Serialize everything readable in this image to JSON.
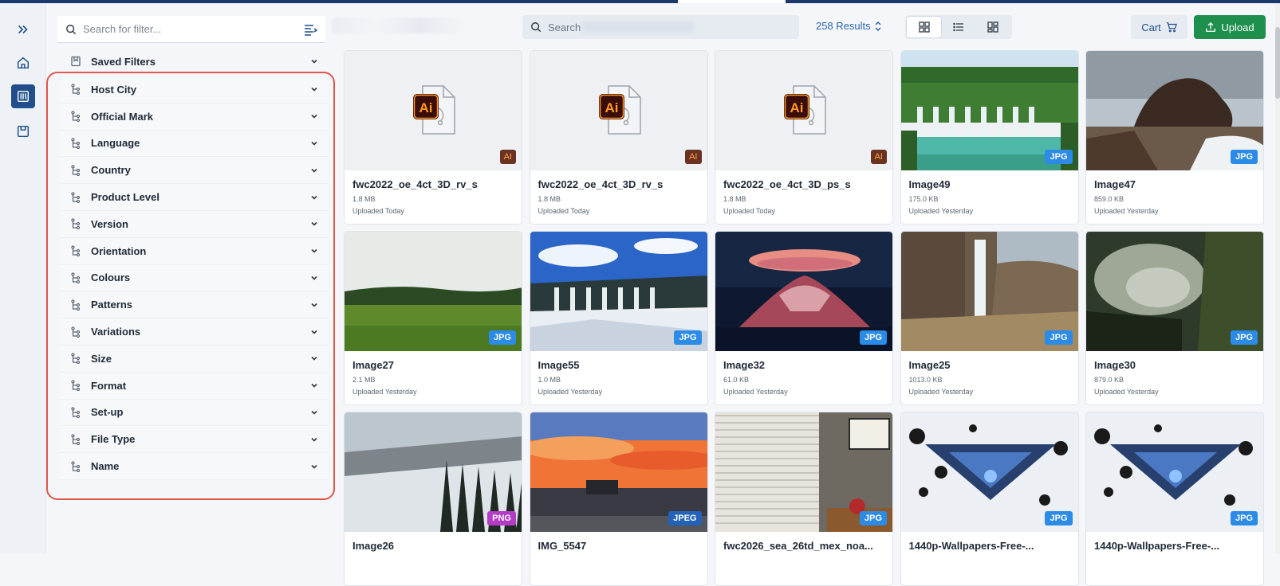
{
  "filter_panel": {
    "search_placeholder": "Search for filter...",
    "saved_filters_label": "Saved Filters",
    "facets": [
      "Host City",
      "Official Mark",
      "Language",
      "Country",
      "Product Level",
      "Version",
      "Orientation",
      "Colours",
      "Patterns",
      "Variations",
      "Size",
      "Format",
      "Set-up",
      "File Type",
      "Name"
    ]
  },
  "toolbar": {
    "search_placeholder": "Search",
    "results_label": "258 Results",
    "cart_label": "Cart",
    "upload_label": "Upload"
  },
  "colors": {
    "brand_navy": "#1f4e8a",
    "upload_green": "#1f8f4e",
    "highlight_red": "#e0584a",
    "jpg_badge": "#2b8be6",
    "png_badge": "#b43bc6"
  },
  "assets": [
    {
      "title": "fwc2022_oe_4ct_3D_rv_s",
      "size": "1.8 MB",
      "uploaded": "Uploaded Today",
      "badge": "AI",
      "kind": "ai"
    },
    {
      "title": "fwc2022_oe_4ct_3D_rv_s",
      "size": "1.8 MB",
      "uploaded": "Uploaded Today",
      "badge": "AI",
      "kind": "ai"
    },
    {
      "title": "fwc2022_oe_4ct_3D_ps_s",
      "size": "1.8 MB",
      "uploaded": "Uploaded Today",
      "badge": "AI",
      "kind": "ai"
    },
    {
      "title": "Image49",
      "size": "175.0 KB",
      "uploaded": "Uploaded Yesterday",
      "badge": "JPG",
      "kind": "waterfall"
    },
    {
      "title": "Image47",
      "size": "859.0 KB",
      "uploaded": "Uploaded Yesterday",
      "badge": "JPG",
      "kind": "rock"
    },
    {
      "title": "Image27",
      "size": "2.1 MB",
      "uploaded": "Uploaded Yesterday",
      "badge": "JPG",
      "kind": "meadow"
    },
    {
      "title": "Image55",
      "size": "1.0 MB",
      "uploaded": "Uploaded Yesterday",
      "badge": "JPG",
      "kind": "snowfall"
    },
    {
      "title": "Image32",
      "size": "61.0 KB",
      "uploaded": "Uploaded Yesterday",
      "badge": "JPG",
      "kind": "volcano"
    },
    {
      "title": "Image25",
      "size": "1013.0 KB",
      "uploaded": "Uploaded Yesterday",
      "badge": "JPG",
      "kind": "cliff"
    },
    {
      "title": "Image30",
      "size": "879.0 KB",
      "uploaded": "Uploaded Yesterday",
      "badge": "JPG",
      "kind": "forest"
    },
    {
      "title": "Image26",
      "size": "",
      "uploaded": "",
      "badge": "PNG",
      "kind": "snowtrees"
    },
    {
      "title": "IMG_5547",
      "size": "",
      "uploaded": "",
      "badge": "JPEG",
      "kind": "sunset"
    },
    {
      "title": "fwc2026_sea_26td_mex_noa...",
      "size": "",
      "uploaded": "",
      "badge": "JPG",
      "kind": "office"
    },
    {
      "title": "1440p-Wallpapers-Free-...",
      "size": "",
      "uploaded": "",
      "badge": "JPG",
      "kind": "abstract"
    },
    {
      "title": "1440p-Wallpapers-Free-...",
      "size": "",
      "uploaded": "",
      "badge": "JPG",
      "kind": "abstract"
    }
  ]
}
